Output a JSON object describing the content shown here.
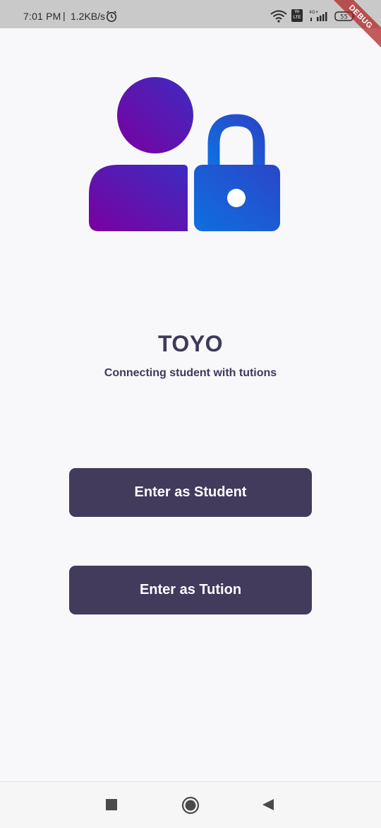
{
  "status_bar": {
    "time": "7:01 PM",
    "separator": "|",
    "network_speed": "1.2KB/s",
    "volte_line1": "Vo",
    "volte_line2": "LTE",
    "battery_text": "55",
    "icons": [
      "alarm-icon",
      "wifi-icon",
      "volte-icon",
      "signal-4g-icon",
      "battery-icon"
    ]
  },
  "debug_banner": "DEBUG",
  "logo": {
    "icon": "user-lock-icon",
    "colors": {
      "user_start": "#7a00a0",
      "user_end": "#3d2cc0",
      "lock_start": "#0f6fe0",
      "lock_end": "#2a46c8"
    }
  },
  "app": {
    "title": "TOYO",
    "tagline": "Connecting student with tutions"
  },
  "buttons": {
    "student_label": "Enter as Student",
    "tution_label": "Enter as Tution"
  },
  "theme": {
    "primary": "#423b5c",
    "background": "#f8f8fa",
    "text": "#3d3a5a"
  },
  "nav_bar": {
    "icons": [
      "recents-icon",
      "home-icon",
      "back-icon"
    ]
  }
}
